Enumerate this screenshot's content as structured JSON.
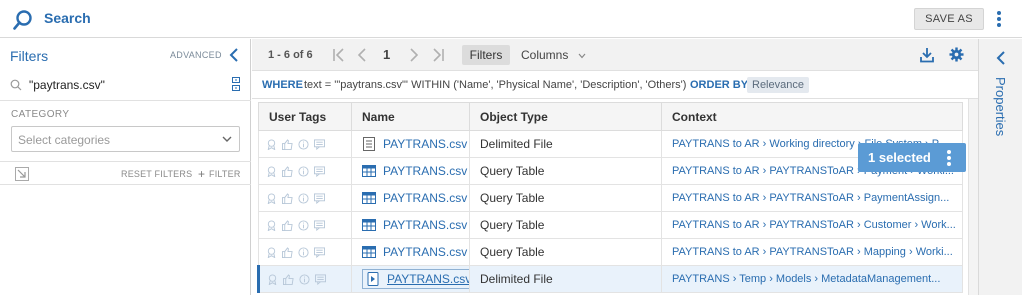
{
  "header": {
    "title": "Search",
    "save_as_label": "SAVE AS"
  },
  "filters": {
    "title": "Filters",
    "advanced_label": "ADVANCED",
    "search_value": "\"paytrans.csv\"",
    "category_label": "CATEGORY",
    "category_placeholder": "Select categories",
    "reset_label": "RESET FILTERS",
    "add_filter_label": "FILTER"
  },
  "toolbar": {
    "range": "1 - 6 of 6",
    "page": "1",
    "filters_label": "Filters",
    "columns_label": "Columns"
  },
  "query": {
    "where": "WHERE",
    "text": "text = '\"paytrans.csv\"' WITHIN ('Name', 'Physical Name', 'Description', 'Others')",
    "order_by": "ORDER BY",
    "order_value": "Relevance"
  },
  "table": {
    "headers": [
      "User Tags",
      "Name",
      "Object Type",
      "Context"
    ],
    "rows": [
      {
        "name": "PAYTRANS.csv",
        "type": "Delimited File",
        "context": "PAYTRANS to AR › Working directory › File System › P",
        "icon": "file-icon"
      },
      {
        "name": "PAYTRANS.csv",
        "type": "Query Table",
        "context": "PAYTRANS to AR › PAYTRANSToAR › Payment › Worki...",
        "icon": "table-icon"
      },
      {
        "name": "PAYTRANS.csv",
        "type": "Query Table",
        "context": "PAYTRANS to AR › PAYTRANSToAR › PaymentAssign...",
        "icon": "table-icon"
      },
      {
        "name": "PAYTRANS.csv",
        "type": "Query Table",
        "context": "PAYTRANS to AR › PAYTRANSToAR › Customer › Work...",
        "icon": "table-icon"
      },
      {
        "name": "PAYTRANS.csv",
        "type": "Query Table",
        "context": "PAYTRANS to AR › PAYTRANSToAR › Mapping › Worki...",
        "icon": "table-icon"
      },
      {
        "name": "PAYTRANS.csv",
        "type": "Delimited File",
        "context": "PAYTRANS › Temp › Models › MetadataManagement...",
        "icon": "file-icon"
      }
    ]
  },
  "selection": {
    "label": "1 selected"
  },
  "properties": {
    "label": "Properties"
  },
  "colors": {
    "accent": "#2a6db0",
    "selected_badge": "#5b9bd5",
    "selected_row": "#e9f2fb"
  }
}
